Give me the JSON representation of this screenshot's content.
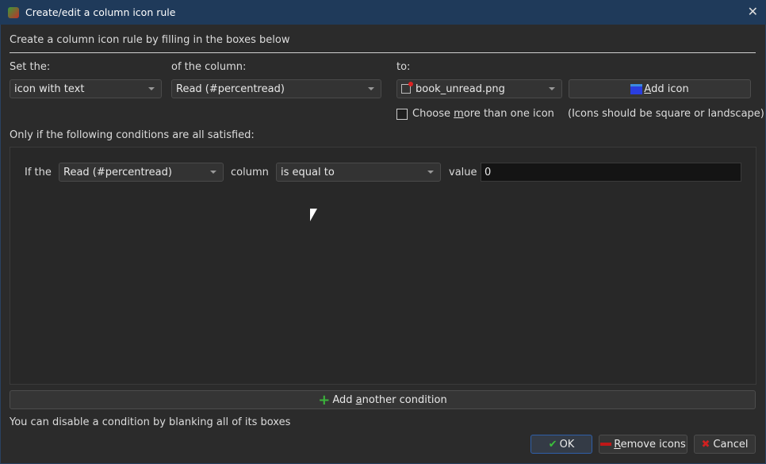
{
  "window": {
    "title": "Create/edit a column icon rule"
  },
  "intro": "Create a column icon rule by filling in the boxes below",
  "labels": {
    "set_the": "Set the:",
    "of_the_column": "of the column:",
    "to": "to:"
  },
  "set_the_value": "icon with text",
  "column_value": "Read (#percentread)",
  "icon_value": "book_unread.png",
  "add_icon": {
    "pre": "",
    "u": "A",
    "post": "dd icon"
  },
  "choose_more": {
    "pre": "Choose ",
    "u": "m",
    "post": "ore than one icon"
  },
  "icons_hint": "(Icons should be square or landscape)",
  "conditions_label": "Only if the following conditions are all satisfied:",
  "condition": {
    "if_the": "If the",
    "column_select": "Read (#percentread)",
    "column_label": "column",
    "operator": "is equal to",
    "value_label": "value",
    "value": "0"
  },
  "add_condition": {
    "pre": "Add ",
    "u": "a",
    "post": "nother condition"
  },
  "disable_hint": "You can disable a condition by blanking all of its boxes",
  "buttons": {
    "ok": "OK",
    "remove": {
      "u": "R",
      "post": "emove icons"
    },
    "cancel": "Cancel"
  }
}
